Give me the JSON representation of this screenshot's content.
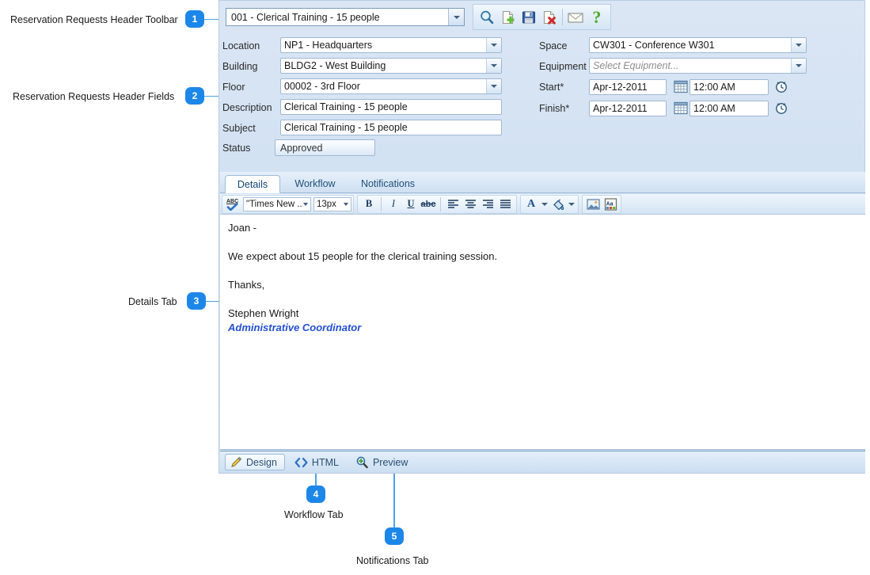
{
  "annotations": [
    {
      "num": "1",
      "label": "Reservation Requests Header Toolbar"
    },
    {
      "num": "2",
      "label": "Reservation Requests Header Fields"
    },
    {
      "num": "3",
      "label": "Details Tab"
    },
    {
      "num": "4",
      "label": "Workflow Tab"
    },
    {
      "num": "5",
      "label": "Notifications Tab"
    }
  ],
  "colors": {
    "accent": "#1c87e8",
    "leader_line": "#4aa3e8",
    "panel_bg": "#cfe0f2",
    "signature_title": "#2450d0",
    "tab_text": "#1f4f79"
  },
  "header_toolbar": {
    "record_selector": {
      "value": "001 - Clerical Training - 15 people",
      "dropdown_icon": "chevron-down-icon"
    },
    "buttons": [
      {
        "name": "find-button",
        "icon": "magnifier-icon",
        "tooltip": "Find"
      },
      {
        "name": "new-button",
        "icon": "new-document-icon",
        "tooltip": "New"
      },
      {
        "name": "save-button",
        "icon": "floppy-disk-icon",
        "tooltip": "Save"
      },
      {
        "name": "delete-button",
        "icon": "document-delete-icon",
        "tooltip": "Delete"
      },
      {
        "name": "email-button",
        "icon": "envelope-icon",
        "tooltip": "Email"
      },
      {
        "name": "help-button",
        "icon": "question-mark-icon",
        "tooltip": "Help"
      }
    ]
  },
  "header_fields": {
    "left": [
      {
        "label": "Location",
        "value": "NP1 - Headquarters",
        "type": "combo"
      },
      {
        "label": "Building",
        "value": "BLDG2 - West Building",
        "type": "combo"
      },
      {
        "label": "Floor",
        "value": "00002 - 3rd Floor",
        "type": "combo"
      },
      {
        "label": "Description",
        "value": "Clerical Training - 15 people",
        "type": "text"
      },
      {
        "label": "Subject",
        "value": "Clerical Training - 15 people",
        "type": "text"
      },
      {
        "label": "Status",
        "value": "Approved",
        "type": "select"
      }
    ],
    "right": {
      "space": {
        "label": "Space",
        "value": "CW301 - Conference W301"
      },
      "equipment": {
        "label": "Equipment",
        "value": "",
        "placeholder": "Select Equipment..."
      },
      "start": {
        "label": "Start*",
        "date": "Apr-12-2011",
        "time": "12:00 AM"
      },
      "finish": {
        "label": "Finish*",
        "date": "Apr-12-2011",
        "time": "12:00 AM"
      },
      "date_picker_icon": "calendar-icon",
      "time_picker_icon": "clock-icon"
    }
  },
  "tabs": [
    {
      "label": "Details",
      "active": true
    },
    {
      "label": "Workflow",
      "active": false
    },
    {
      "label": "Notifications",
      "active": false
    }
  ],
  "editor_toolbar": {
    "spellcheck_icon": "spellcheck-abc-icon",
    "font_family": "\"Times New ...",
    "font_size": "13px",
    "bold": "B",
    "italic": "I",
    "underline": "U",
    "strikethrough": "abc",
    "align_left_icon": "align-left-icon",
    "align_center_icon": "align-center-icon",
    "align_right_icon": "align-right-icon",
    "align_justify_icon": "align-justify-icon",
    "font_color": "A",
    "highlight_icon": "paint-bucket-icon",
    "insert_image_icon": "insert-image-icon",
    "insert_special_icon": "insert-field-icon"
  },
  "editor_body": {
    "greeting": "Joan -",
    "paragraph": "We expect about 15 people for the clerical training session.",
    "closing": "Thanks,",
    "signature_name": "Stephen Wright",
    "signature_title": "Administrative Coordinator"
  },
  "editor_footer_tabs": [
    {
      "label": "Design",
      "icon": "pencil-icon",
      "active": true
    },
    {
      "label": "HTML",
      "icon": "angle-brackets-icon",
      "active": false
    },
    {
      "label": "Preview",
      "icon": "magnifier-plus-icon",
      "active": false
    }
  ]
}
